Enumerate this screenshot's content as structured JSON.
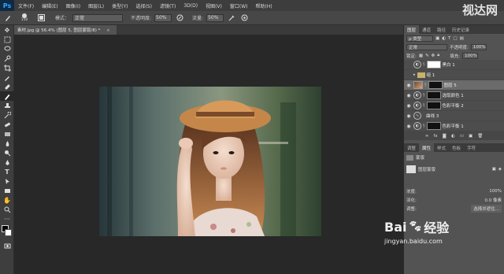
{
  "menubar": {
    "logo": "Ps",
    "items": [
      "文件(F)",
      "编辑(E)",
      "图像(I)",
      "图层(L)",
      "类型(Y)",
      "选择(S)",
      "滤镜(T)",
      "3D(D)",
      "视图(V)",
      "窗口(W)",
      "帮助(H)"
    ]
  },
  "options": {
    "brush_size": "150",
    "mode_label": "模式：",
    "mode_value": "正常",
    "opacity_label": "不透明度:",
    "opacity_value": "50%",
    "flow_label": "流量:",
    "flow_value": "50%"
  },
  "document": {
    "tab_title": "素材.jpg @ 56.4% (图层 5, 图层蒙版/8) *",
    "close": "×"
  },
  "panels": {
    "tabs": [
      "图层",
      "通道",
      "路径",
      "历史记录"
    ],
    "kind_label": "ρ 类型",
    "blend_mode": "正常",
    "opacity_label": "不透明度:",
    "opacity_value": "100%",
    "lock_label": "锁定:",
    "fill_label": "填充:",
    "fill_value": "100%",
    "layers": [
      {
        "name": "黑白 1",
        "type": "adjustment",
        "visible": false,
        "mask": "white"
      },
      {
        "name": "组 1",
        "type": "group",
        "visible": false
      },
      {
        "name": "图层 5",
        "type": "image",
        "visible": true,
        "selected": true,
        "mask": "black"
      },
      {
        "name": "选取颜色 1",
        "type": "adjustment",
        "visible": true,
        "mask": "black"
      },
      {
        "name": "色彩平衡 2",
        "type": "adjustment",
        "visible": true,
        "mask": "black"
      },
      {
        "name": "曲线 3",
        "type": "adjustment",
        "visible": true
      },
      {
        "name": "色彩平衡 1",
        "type": "adjustment",
        "visible": true,
        "mask": "black"
      }
    ],
    "props_tabs": [
      "调整",
      "属性",
      "样式",
      "色板",
      "字符"
    ],
    "props_title": "蒙版",
    "props_layer_mask": "图层蒙版",
    "density_label": "浓度:",
    "density_value": "100%",
    "feather_label": "羽化:",
    "feather_value": "0.0 像素",
    "adjust_label": "调整:",
    "select_btn": "选择并遮住..."
  },
  "watermark": {
    "top": "视达网",
    "baidu_text": "Bai",
    "baidu_cn": "经验",
    "url": "jingyan.baidu.com"
  }
}
